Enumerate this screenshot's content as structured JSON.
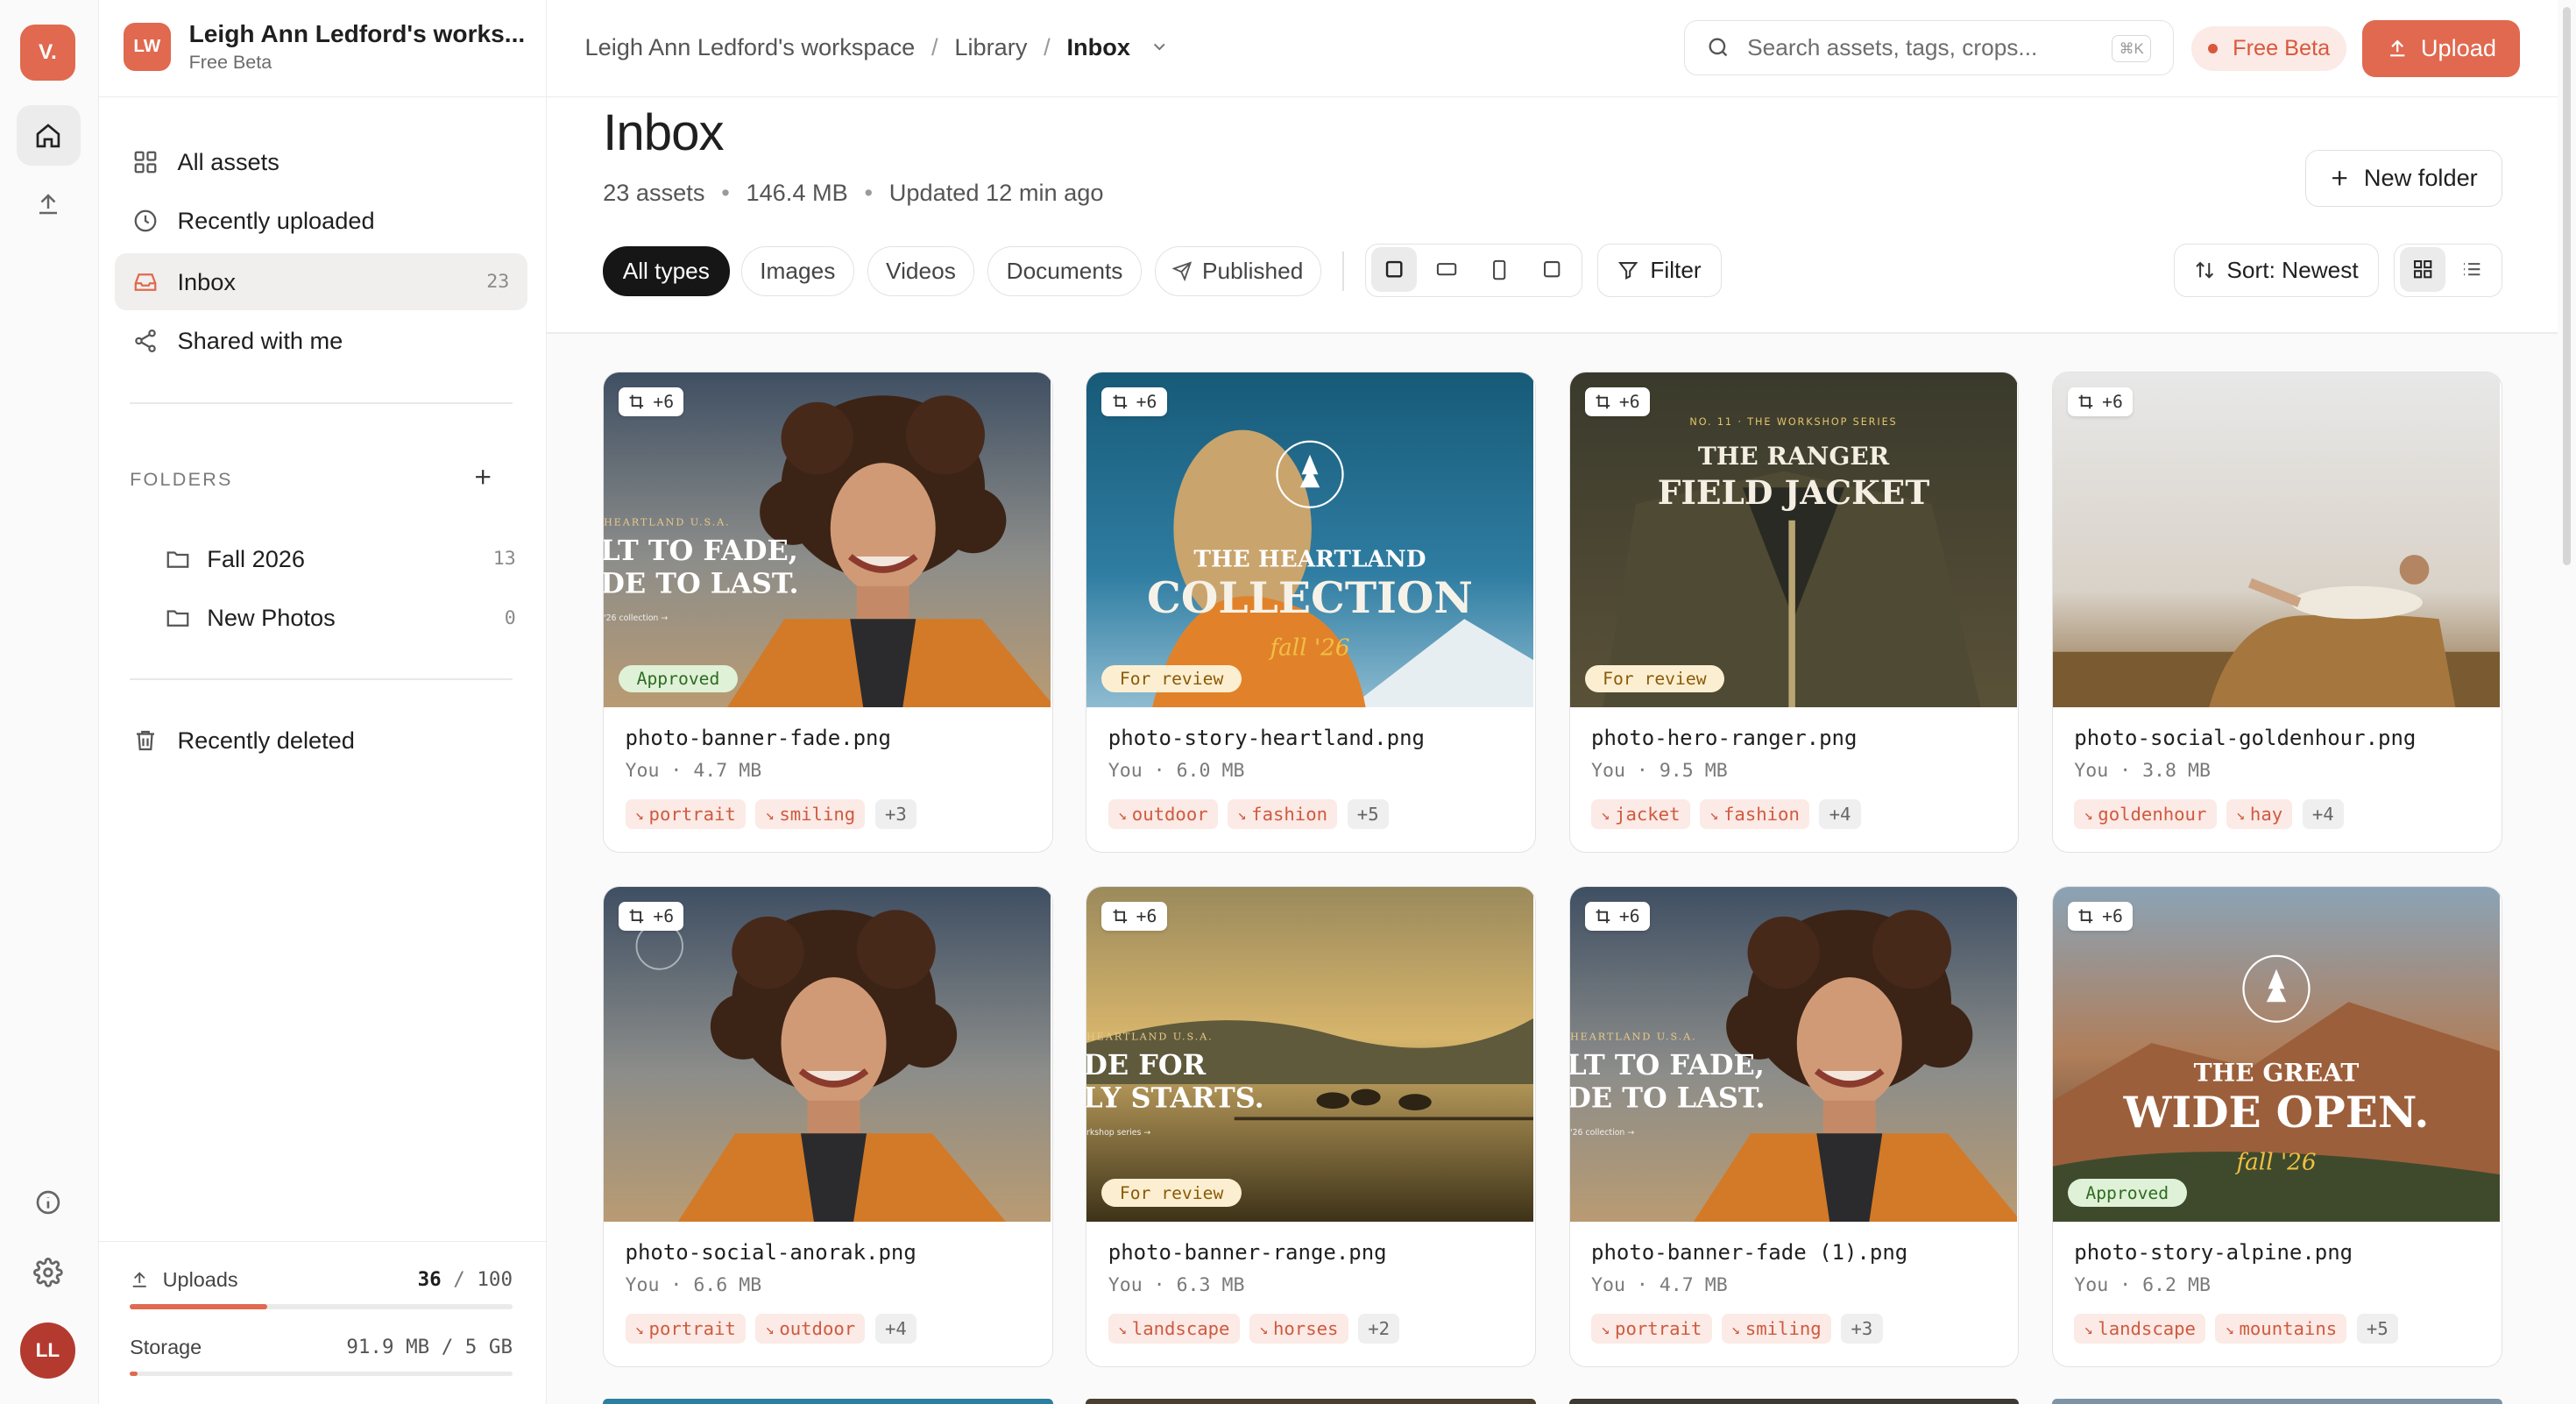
{
  "app": {
    "rail_logo": "V.",
    "user_initials": "LL"
  },
  "workspace": {
    "badge": "LW",
    "name": "Leigh Ann Ledford's works...",
    "plan": "Free Beta"
  },
  "sidebar": {
    "nav": [
      {
        "label": "All assets",
        "icon": "grid-icon",
        "count": ""
      },
      {
        "label": "Recently uploaded",
        "icon": "clock-icon",
        "count": ""
      },
      {
        "label": "Inbox",
        "icon": "inbox-icon",
        "count": "23"
      },
      {
        "label": "Shared with me",
        "icon": "share-icon",
        "count": ""
      }
    ],
    "folders_heading": "FOLDERS",
    "folders": [
      {
        "label": "Fall 2026",
        "count": "13"
      },
      {
        "label": "New Photos",
        "count": "0"
      }
    ],
    "recently_deleted": "Recently deleted",
    "usage": {
      "uploads_label": "Uploads",
      "uploads_used": "36",
      "uploads_total": "100",
      "uploads_fraction": 0.36,
      "storage_label": "Storage",
      "storage_value": "91.9 MB / 5 GB",
      "storage_fraction": 0.018
    }
  },
  "topbar": {
    "breadcrumb": [
      "Leigh Ann Ledford's workspace",
      "Library",
      "Inbox"
    ],
    "search_placeholder": "Search assets, tags, crops...",
    "search_shortcut": "⌘K",
    "beta_label": "Free Beta",
    "upload_label": "Upload"
  },
  "page": {
    "title": "Inbox",
    "asset_count": "23 assets",
    "size": "146.4 MB",
    "updated": "Updated 12 min ago",
    "new_folder_label": "New folder",
    "filters": [
      "All types",
      "Images",
      "Videos",
      "Documents",
      "Published"
    ],
    "filter_label": "Filter",
    "sort_label": "Sort: Newest"
  },
  "assets": [
    {
      "name": "photo-banner-fade.png",
      "meta": "You · 4.7 MB",
      "crops": "+6",
      "status": "Approved",
      "tags": [
        "portrait",
        "smiling"
      ],
      "more": "+3",
      "overlay": {
        "kicker": "HEARTLAND U.S.A.",
        "line1": "LT TO FADE,",
        "line2": "DE TO LAST.",
        "small": "'26 collection →"
      }
    },
    {
      "name": "photo-story-heartland.png",
      "meta": "You · 6.0 MB",
      "crops": "+6",
      "status": "For review",
      "tags": [
        "outdoor",
        "fashion"
      ],
      "more": "+5",
      "overlay": {
        "line1": "THE HEARTLAND",
        "line2": "COLLECTION",
        "script": "fall '26"
      }
    },
    {
      "name": "photo-hero-ranger.png",
      "meta": "You · 9.5 MB",
      "crops": "+6",
      "status": "For review",
      "tags": [
        "jacket",
        "fashion"
      ],
      "more": "+4",
      "overlay": {
        "kicker": "NO. 11 · THE WORKSHOP SERIES",
        "line1": "THE RANGER",
        "line2": "FIELD JACKET"
      }
    },
    {
      "name": "photo-social-goldenhour.png",
      "meta": "You · 3.8 MB",
      "crops": "+6",
      "status": "",
      "tags": [
        "goldenhour",
        "hay"
      ],
      "more": "+4",
      "overlay": {}
    },
    {
      "name": "photo-social-anorak.png",
      "meta": "You · 6.6 MB",
      "crops": "+6",
      "status": "",
      "tags": [
        "portrait",
        "outdoor"
      ],
      "more": "+4",
      "overlay": {}
    },
    {
      "name": "photo-banner-range.png",
      "meta": "You · 6.3 MB",
      "crops": "+6",
      "status": "For review",
      "tags": [
        "landscape",
        "horses"
      ],
      "more": "+2",
      "overlay": {
        "kicker": "HEARTLAND U.S.A.",
        "line1": "DE FOR",
        "line2": "LY STARTS.",
        "small": "rkshop series →"
      }
    },
    {
      "name": "photo-banner-fade (1).png",
      "meta": "You · 4.7 MB",
      "crops": "+6",
      "status": "",
      "tags": [
        "portrait",
        "smiling"
      ],
      "more": "+3",
      "overlay": {
        "kicker": "HEARTLAND U.S.A.",
        "line1": "LT TO FADE,",
        "line2": "DE TO LAST.",
        "small": "'26 collection →"
      }
    },
    {
      "name": "photo-story-alpine.png",
      "meta": "You · 6.2 MB",
      "crops": "+6",
      "status": "Approved",
      "tags": [
        "landscape",
        "mountains"
      ],
      "more": "+5",
      "overlay": {
        "line1": "THE GREAT",
        "line2": "WIDE OPEN.",
        "script": "fall '26"
      }
    }
  ],
  "colors": {
    "accent": "#e0694f",
    "approved_bg": "#dff1d6",
    "review_bg": "#fcefd1",
    "tag_bg": "#fbeae5"
  }
}
